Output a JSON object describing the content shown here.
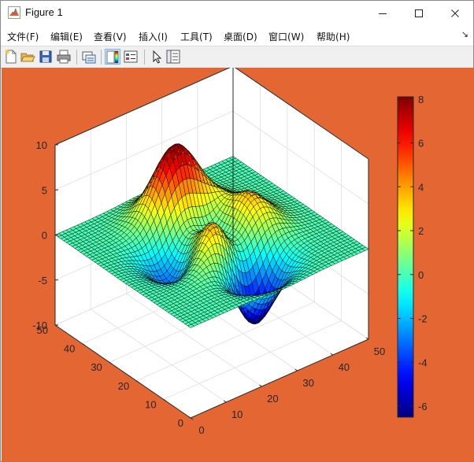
{
  "window": {
    "title": "Figure 1",
    "controls": {
      "minimize": "minimize",
      "maximize": "maximize",
      "close": "close"
    }
  },
  "menu": [
    {
      "label": "文件",
      "mnemonic": "(F)"
    },
    {
      "label": "编辑",
      "mnemonic": "(E)"
    },
    {
      "label": "查看",
      "mnemonic": "(V)"
    },
    {
      "label": "插入",
      "mnemonic": "(I)"
    },
    {
      "label": "工具",
      "mnemonic": "(T)"
    },
    {
      "label": "桌面",
      "mnemonic": "(D)"
    },
    {
      "label": "窗口",
      "mnemonic": "(W)"
    },
    {
      "label": "帮助",
      "mnemonic": "(H)"
    }
  ],
  "toolbar": {
    "buttons": [
      "new-figure-icon",
      "open-file-icon",
      "save-figure-icon",
      "print-figure-icon",
      "link-plot-icon",
      "colorbar-icon",
      "legend-icon",
      "edit-plot-pointer-icon",
      "property-inspector-icon"
    ],
    "toggled": [
      "colorbar-icon"
    ]
  },
  "figure": {
    "background_color": "#E36633",
    "colormap": "jet",
    "colorbar_ticks": [
      "8",
      "6",
      "4",
      "2",
      "0",
      "-2",
      "-4",
      "-6"
    ],
    "z_ticks": [
      "10",
      "5",
      "0",
      "-5",
      "-10"
    ],
    "y_ticks": [
      "50",
      "40",
      "30",
      "20",
      "10",
      "0"
    ],
    "x_ticks": [
      "0",
      "10",
      "20",
      "30",
      "40",
      "50"
    ]
  },
  "chart_data": {
    "type": "surface",
    "function": "peaks",
    "grid_size": 49,
    "x_range": [
      0,
      50
    ],
    "y_range": [
      0,
      50
    ],
    "zlim": [
      -10,
      10
    ],
    "clim": [
      -6.5,
      8.1
    ],
    "colorbar_range": [
      -6.5,
      8.1
    ],
    "grid": true,
    "colorbar_location": "right",
    "view": "3-D default"
  }
}
